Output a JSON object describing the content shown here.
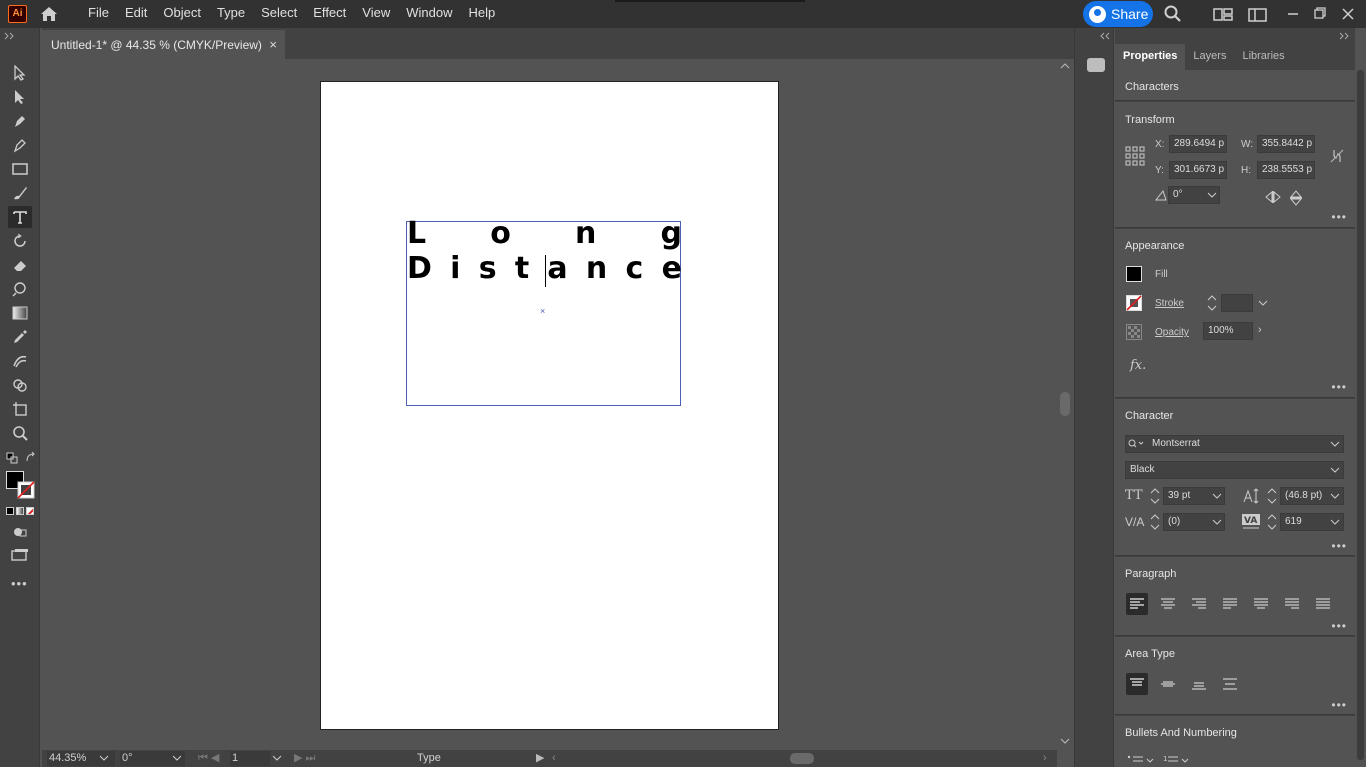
{
  "app": {
    "logo": "Ai"
  },
  "menu": [
    "File",
    "Edit",
    "Object",
    "Type",
    "Select",
    "Effect",
    "View",
    "Window",
    "Help"
  ],
  "share_label": "Share",
  "document_tab": {
    "title": "Untitled-1* @ 44.35 % (CMYK/Preview)",
    "close": "×"
  },
  "canvas_text": {
    "line1": [
      "L",
      "o",
      "n",
      "g"
    ],
    "line2": [
      "D",
      "i",
      "s",
      "t",
      "a",
      "n",
      "c",
      "e"
    ]
  },
  "status": {
    "zoom": "44.35%",
    "rotation": "0°",
    "artboard": "1",
    "tool": "Type"
  },
  "panel": {
    "tabs": [
      "Properties",
      "Layers",
      "Libraries"
    ],
    "selection_type": "Characters",
    "transform": {
      "title": "Transform",
      "x_label": "X:",
      "x": "289.6494 p",
      "y_label": "Y:",
      "y": "301.6673 p",
      "w_label": "W:",
      "w": "355.8442 p",
      "h_label": "H:",
      "h": "238.5553 p",
      "angle": "0°"
    },
    "appearance": {
      "title": "Appearance",
      "fill": "Fill",
      "stroke": "Stroke",
      "opacity": "Opacity",
      "opacity_value": "100%",
      "fx": "fx."
    },
    "character": {
      "title": "Character",
      "font_family": "Montserrat",
      "font_style": "Black",
      "size": "39 pt",
      "leading": "(46.8 pt)",
      "kerning": "(0)",
      "tracking": "619"
    },
    "paragraph": {
      "title": "Paragraph"
    },
    "area_type": {
      "title": "Area Type"
    },
    "bullets": {
      "title": "Bullets And Numbering"
    }
  },
  "colors": {
    "accent": "#1473e6",
    "frame": "#4d5fb3"
  }
}
